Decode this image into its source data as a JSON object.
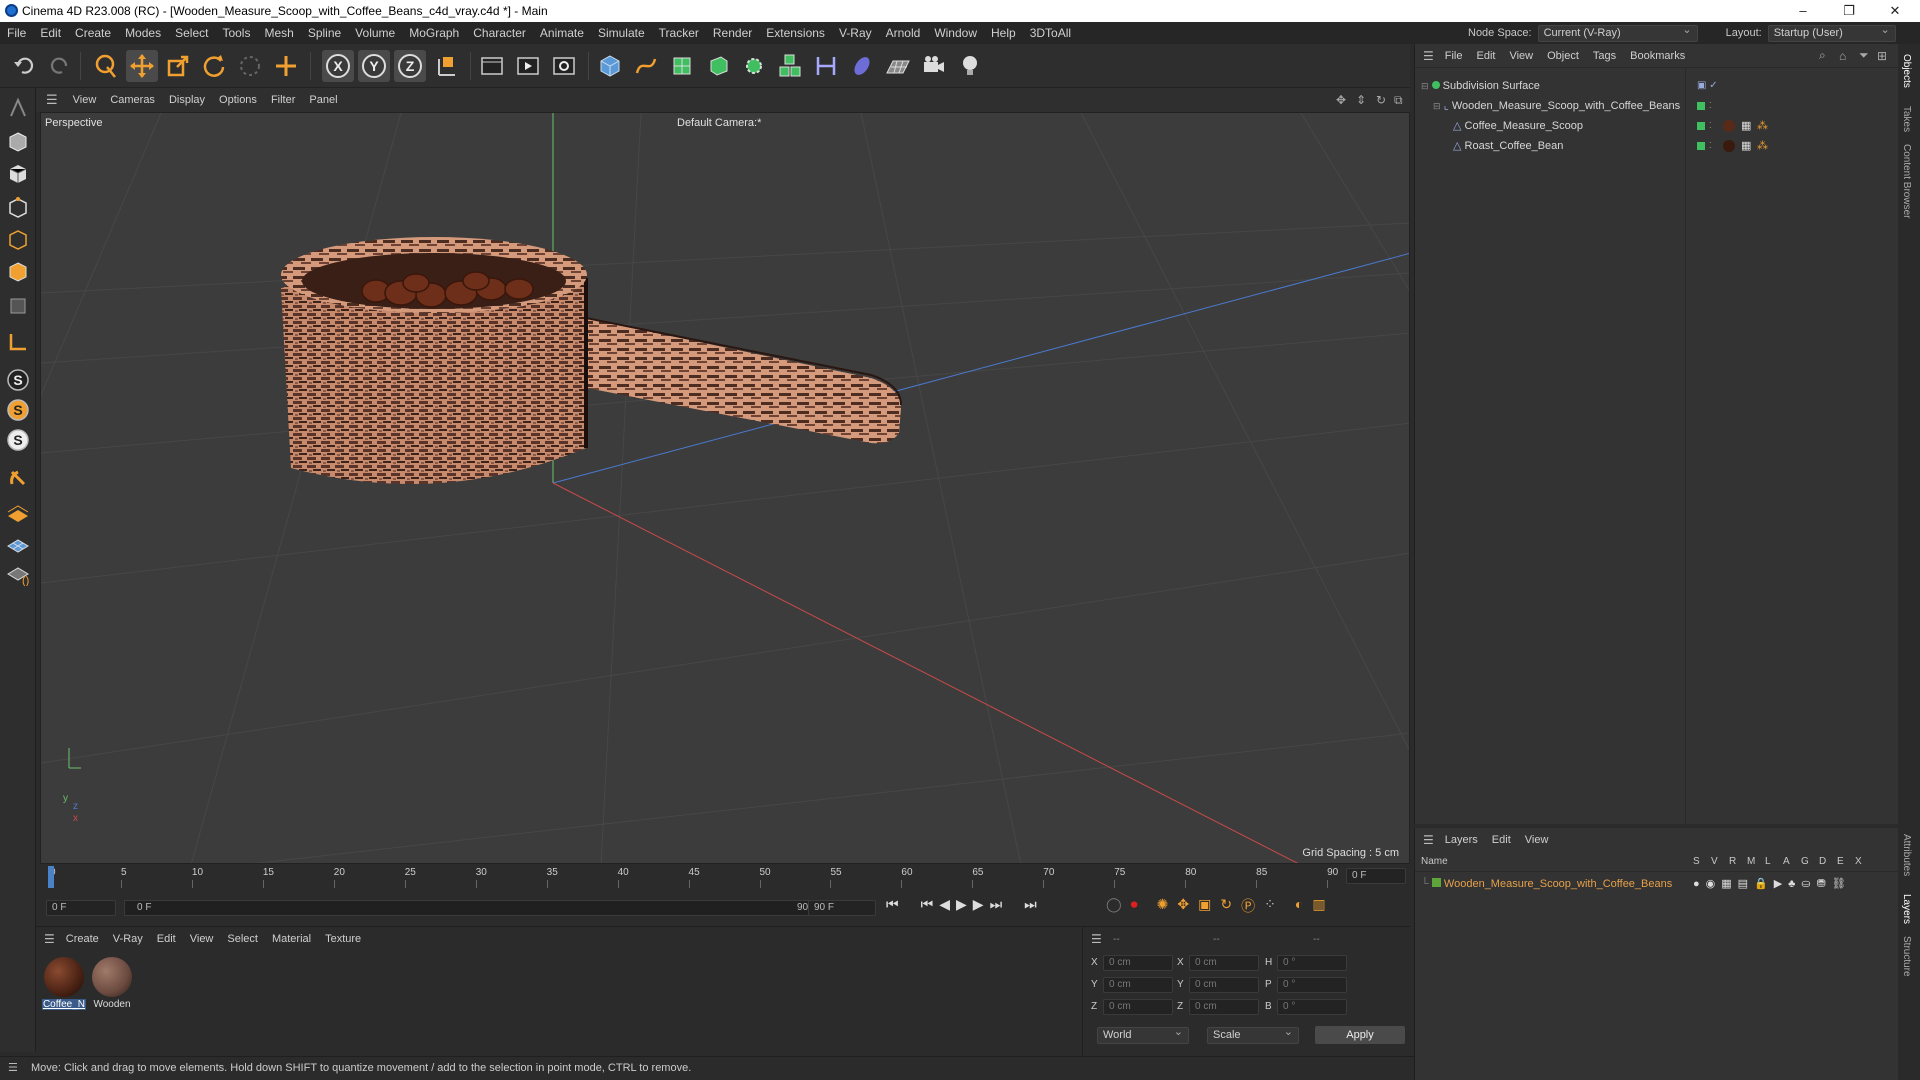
{
  "window": {
    "title": "Cinema 4D R23.008 (RC) - [Wooden_Measure_Scoop_with_Coffee_Beans_c4d_vray.c4d *] - Main",
    "minimize": "–",
    "maximize": "❐",
    "close": "✕"
  },
  "menubar": {
    "items": [
      "File",
      "Edit",
      "Create",
      "Modes",
      "Select",
      "Tools",
      "Mesh",
      "Spline",
      "Volume",
      "MoGraph",
      "Character",
      "Animate",
      "Simulate",
      "Tracker",
      "Render",
      "Extensions",
      "V-Ray",
      "Arnold",
      "Window",
      "Help",
      "3DToAll"
    ],
    "node_space_label": "Node Space:",
    "node_space_value": "Current (V-Ray)",
    "layout_label": "Layout:",
    "layout_value": "Startup (User)"
  },
  "viewport": {
    "menu": [
      "View",
      "Cameras",
      "Display",
      "Options",
      "Filter",
      "Panel"
    ],
    "perspective_label": "Perspective",
    "camera_label": "Default Camera",
    "camera_suffix": ":*",
    "grid_spacing": "Grid Spacing : 5 cm",
    "axis_y": "y",
    "axis_z": "z",
    "axis_x": "x"
  },
  "timeline": {
    "ticks": [
      "0",
      "5",
      "10",
      "15",
      "20",
      "25",
      "30",
      "35",
      "40",
      "45",
      "50",
      "55",
      "60",
      "65",
      "70",
      "75",
      "80",
      "85",
      "90"
    ],
    "current_frame": "0 F",
    "start_field": "0 F",
    "range_start": "0 F",
    "range_end": "90 F",
    "end_field": "90 F"
  },
  "objects": {
    "menu": [
      "File",
      "Edit",
      "View",
      "Object",
      "Tags",
      "Bookmarks"
    ],
    "tree": [
      {
        "name": "Subdivision Surface",
        "level": 0
      },
      {
        "name": "Wooden_Measure_Scoop_with_Coffee_Beans",
        "level": 1
      },
      {
        "name": "Coffee_Measure_Scoop",
        "level": 2
      },
      {
        "name": "Roast_Coffee_Bean",
        "level": 2
      }
    ]
  },
  "layers": {
    "menu": [
      "Layers",
      "Edit",
      "View"
    ],
    "name_header": "Name",
    "cols": [
      "S",
      "V",
      "R",
      "M",
      "L",
      "A",
      "G",
      "D",
      "E",
      "X"
    ],
    "rows": [
      {
        "name": "Wooden_Measure_Scoop_with_Coffee_Beans",
        "color": "#5fa63a"
      }
    ]
  },
  "materials": {
    "menu": [
      "Create",
      "V-Ray",
      "Edit",
      "View",
      "Select",
      "Material",
      "Texture"
    ],
    "items": [
      {
        "label": "Coffee_N",
        "color": "#4a2214"
      },
      {
        "label": "Wooden",
        "color": "#6b4a3f"
      }
    ]
  },
  "coords": {
    "headers": [
      "--",
      "--",
      "--"
    ],
    "rows": [
      {
        "a": "X",
        "av": "0 cm",
        "b": "X",
        "bv": "0 cm",
        "c": "H",
        "cv": "0 °"
      },
      {
        "a": "Y",
        "av": "0 cm",
        "b": "Y",
        "bv": "0 cm",
        "c": "P",
        "cv": "0 °"
      },
      {
        "a": "Z",
        "av": "0 cm",
        "b": "Z",
        "bv": "0 cm",
        "c": "B",
        "cv": "0 °"
      }
    ],
    "mode1": "World",
    "mode2": "Scale",
    "apply": "Apply"
  },
  "side_tabs": [
    "Objects",
    "Takes",
    "Content Browser",
    "Attributes",
    "Layers",
    "Structure"
  ],
  "status": "Move: Click and drag to move elements. Hold down SHIFT to quantize movement / add to the selection in point mode, CTRL to remove.",
  "colors": {
    "accent": "#4a82c8",
    "orange": "#f0a030",
    "selection": "#e6a04a"
  }
}
